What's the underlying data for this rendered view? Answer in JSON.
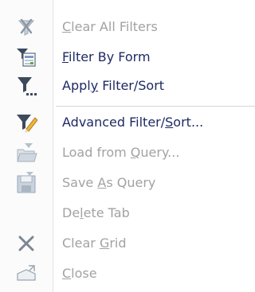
{
  "menu": {
    "items": [
      {
        "pre": "",
        "key": "C",
        "post": "lear All Filters",
        "enabled": false,
        "icon": "clear-filter-icon"
      },
      {
        "pre": "",
        "key": "F",
        "post": "ilter By Form",
        "enabled": true,
        "icon": "filter-by-form-icon"
      },
      {
        "pre": "Appl",
        "key": "y",
        "post": " Filter/Sort",
        "enabled": true,
        "icon": "apply-filter-icon"
      },
      {
        "pre": "Advanced Filter/",
        "key": "S",
        "post": "ort...",
        "enabled": true,
        "icon": "advanced-filter-icon"
      },
      {
        "pre": "Load from ",
        "key": "Q",
        "post": "uery...",
        "enabled": false,
        "icon": "load-query-icon"
      },
      {
        "pre": "Save ",
        "key": "A",
        "post": "s Query",
        "enabled": false,
        "icon": "save-query-icon"
      },
      {
        "pre": "De",
        "key": "l",
        "post": "ete Tab",
        "enabled": false,
        "icon": ""
      },
      {
        "pre": "Clear ",
        "key": "G",
        "post": "rid",
        "enabled": false,
        "icon": "clear-grid-icon"
      },
      {
        "pre": "",
        "key": "C",
        "post": "lose",
        "enabled": false,
        "icon": "close-window-icon"
      }
    ]
  },
  "colors": {
    "enabled_text": "#1e2a64",
    "disabled_text": "#a2a2a2",
    "gutter": "#fbfbfb",
    "separator": "#d5d5d5"
  }
}
